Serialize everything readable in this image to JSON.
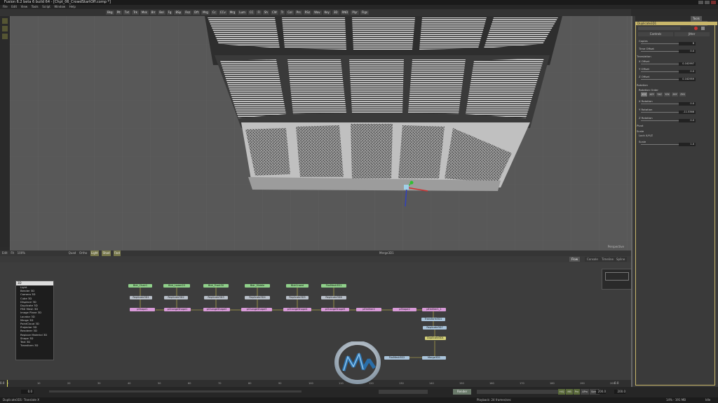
{
  "app": {
    "title": "Fusion 6.2 beta 6 build 64 - [Chpt_06_CrowdStartOff.comp *]"
  },
  "menu": [
    "File",
    "Edit",
    "View",
    "Tools",
    "Script",
    "Window",
    "Help"
  ],
  "toolbar": {
    "buttons": [
      "Bkg",
      "Plt",
      "Txt",
      "Trk",
      "Msk",
      "Blr",
      "Bol",
      "Fg",
      "BSp",
      "Rsz",
      "Dft",
      "Mrg",
      "Cc",
      "CCv",
      "Mrg",
      "Lum",
      "CC",
      "Fl",
      "Sh",
      "CW",
      "Tr",
      "Col",
      "Prs",
      "RSz",
      "Wav",
      "Key",
      "3D",
      "RND",
      "Plyr",
      "Flgs"
    ]
  },
  "viewport": {
    "label": "Perspective",
    "colors": {
      "background": "#585858",
      "grid": "#6a6a6a",
      "stadium": "#b5b5b5"
    }
  },
  "viewbar": {
    "items": [
      "Edit",
      "Fit",
      "100%",
      "Quad",
      "Ortho",
      "Light",
      "Shad",
      "Fast"
    ],
    "center_label": "Merge3D1"
  },
  "flowbar": {
    "tabs": [
      "Flow",
      "Console",
      "Timeline",
      "Spline"
    ]
  },
  "flow": {
    "nodes": [
      {
        "name": "node-green-1",
        "label": "Bldr_Chair1"
      },
      {
        "name": "node-green-2",
        "label": "Bldr_Lower20"
      },
      {
        "name": "node-green-3",
        "label": "Bldr_Front30"
      },
      {
        "name": "node-green-4",
        "label": "Bldr_Middle"
      },
      {
        "name": "node-green-5",
        "label": "BldrCrowd"
      },
      {
        "name": "node-green-6",
        "label": "FbxMesh3D1"
      },
      {
        "name": "node-gray-1",
        "label": "Replicate3D1"
      },
      {
        "name": "node-gray-2",
        "label": "Replicate3D2"
      },
      {
        "name": "node-gray-3",
        "label": "Replicate3D3"
      },
      {
        "name": "node-gray-4",
        "label": "Replicate3D4"
      },
      {
        "name": "node-gray-5",
        "label": "Replicate3D5"
      },
      {
        "name": "node-gray-6",
        "label": "Replicate3D6"
      },
      {
        "name": "node-pink-1",
        "label": "pShape1"
      },
      {
        "name": "node-pink-2",
        "label": "pChangeShape1"
      },
      {
        "name": "node-pink-3",
        "label": "pChangeShape2"
      },
      {
        "name": "node-pink-4",
        "label": "pChangeShape3"
      },
      {
        "name": "node-pink-5",
        "label": "pChangeShape4"
      },
      {
        "name": "node-pink-6",
        "label": "pChangeShape5"
      },
      {
        "name": "node-pink-7",
        "label": "pEmitter2"
      },
      {
        "name": "node-pink-8",
        "label": "pShape2"
      },
      {
        "name": "node-pink-9",
        "label": "pEmitter1_1"
      },
      {
        "name": "node-blue-1",
        "label": "Transform3D1"
      },
      {
        "name": "node-blue-2",
        "label": "Replicate3D7"
      },
      {
        "name": "node-yellow-1",
        "label": "Duplicate3D1"
      },
      {
        "name": "node-blue-3",
        "label": "FbxMesh3D2"
      },
      {
        "name": "node-blue-4",
        "label": "Merge3D1"
      }
    ]
  },
  "tools_list": {
    "input_value": "3D",
    "items": [
      "Light",
      "Bender 3D",
      "Camera 3D",
      "Cube 3D",
      "Displace 3D",
      "Duplicate 3D",
      "FBX Mesh 3D",
      "Image Plane 3D",
      "Locator 3D",
      "Merge 3D",
      "PointCloud 3D",
      "Projector 3D",
      "Renderer 3D",
      "Replace Material 3D",
      "Shape 3D",
      "Text 3D",
      "Transform 3D"
    ]
  },
  "timeline": {
    "start": "0.0",
    "end": "0.0",
    "ticks": [
      "0",
      "10",
      "20",
      "30",
      "40",
      "50",
      "60",
      "70",
      "80",
      "90",
      "100",
      "110",
      "120",
      "130",
      "140",
      "150",
      "160",
      "170",
      "180",
      "190",
      "200"
    ],
    "current_frame": "0.0",
    "render_label": "Render",
    "playback_fields": [
      "HiQ",
      "MB",
      "Prx",
      "APrx",
      "Some"
    ],
    "end_frame": "200.0",
    "render_end": "200.0",
    "playhead_fraction": 0
  },
  "status": {
    "left": "Duplicate3D1: Translate X",
    "right": "Playback: 24 frames/sec",
    "memory": "14% - 191 MB",
    "idle": "Idle"
  },
  "inspector": {
    "tabs": [
      "Tools",
      "Modifiers"
    ],
    "tool_name": "Duplicate3D1",
    "subtabs": [
      "Controls",
      "Jitter"
    ],
    "params": [
      {
        "label": "Copies",
        "value": "8"
      },
      {
        "label": "Time Offset",
        "value": "0.0"
      },
      {
        "label": "Translation",
        "value": ""
      },
      {
        "label": "X Offset",
        "value": "0.162997"
      },
      {
        "label": "Y Offset",
        "value": "0.0"
      },
      {
        "label": "Z Offset",
        "value": "0.162959"
      },
      {
        "label": "Rotation",
        "value": ""
      },
      {
        "label": "Rotation Order",
        "value": ""
      },
      {
        "label": "X Rotation",
        "value": "0.0"
      },
      {
        "label": "Y Rotation",
        "value": "-11.5366"
      },
      {
        "label": "Z Rotation",
        "value": "0.0"
      },
      {
        "label": "Pivot",
        "value": ""
      },
      {
        "label": "Scale",
        "value": ""
      },
      {
        "label": "Lock X/Y/Z",
        "value": ""
      },
      {
        "label": "Scale",
        "value": "1.0"
      }
    ],
    "rotation_orders": [
      "XYZ",
      "XZY",
      "YXZ",
      "YZX",
      "ZXY",
      "ZYX"
    ]
  }
}
